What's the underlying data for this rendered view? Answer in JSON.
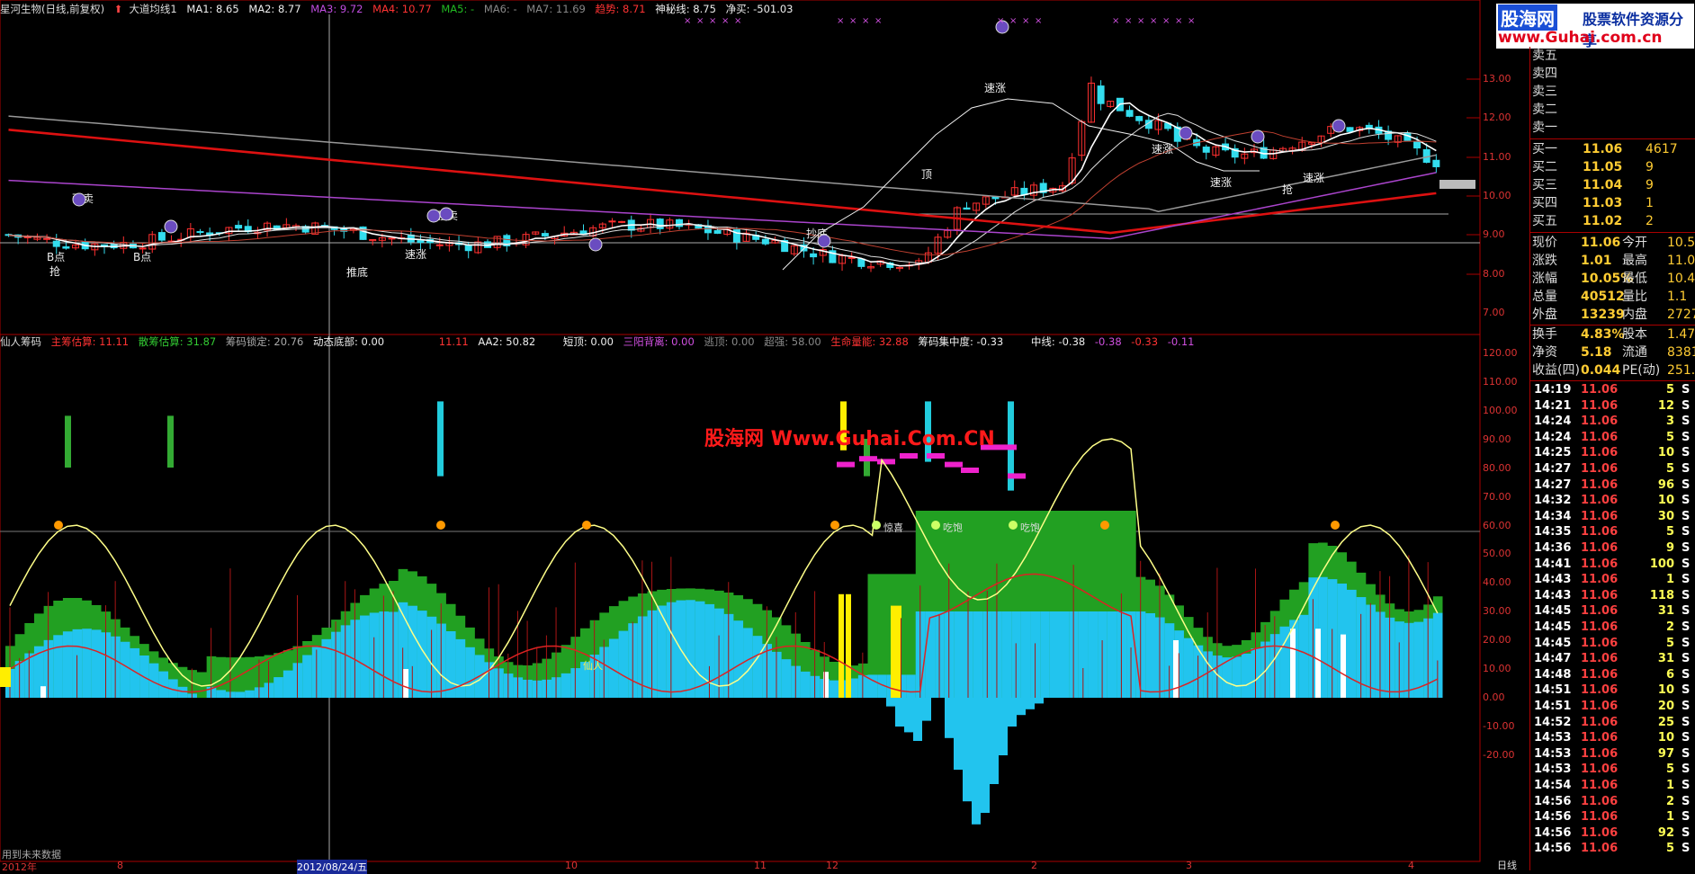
{
  "stock_header": {
    "title": "星河生物(日线,前复权)",
    "indicator": "大道均线1",
    "ma1": "MA1: 8.65",
    "ma2": "MA2: 8.77",
    "ma3": "MA3: 9.72",
    "ma4": "MA4: 10.77",
    "ma5": "MA5: -",
    "ma6": "MA6: -",
    "ma7": "MA7: 11.69",
    "trend": "趋势: 8.71",
    "secret": "神秘线: 8.75",
    "netbuy": "净买: -501.03"
  },
  "indicator_header": {
    "name": "仙人筹码",
    "main": "主筹估算: 11.11",
    "scatter": "散筹估算: 31.87",
    "lock": "筹码锁定: 20.76",
    "dynbottom": "动态底部: 0.00",
    "v1": "11.11",
    "aa2": "AA2: 50.82",
    "short_top": "短顶: 0.00",
    "sanyang": "三阳背离: 0.00",
    "escape": "逃顶: 0.00",
    "super": "超强: 58.00",
    "life": "生命量能: 32.88",
    "concentration": "筹码集中度: -0.33",
    "mid": "中线: -0.38",
    "m1": "-0.38",
    "m2": "-0.33",
    "m3": "-0.11"
  },
  "price_axis": [
    "13.00",
    "12.00",
    "11.00",
    "10.00",
    "9.00",
    "8.00",
    "7.00"
  ],
  "ind_axis": [
    "120.00",
    "110.00",
    "100.00",
    "90.00",
    "80.00",
    "70.00",
    "60.00",
    "50.00",
    "40.00",
    "30.00",
    "20.00",
    "10.00",
    "0.00",
    "-10.00",
    "-20.00"
  ],
  "time_axis": [
    "2012年",
    "8",
    "2012/08/24/五",
    "10",
    "11",
    "12",
    "2",
    "3",
    "4"
  ],
  "price_labels": [
    "顶",
    "速涨",
    "速涨",
    "速涨",
    "速涨",
    "速涨",
    "抢",
    "抄底",
    "抢",
    "B点",
    "B点",
    "推底",
    "强卖",
    "强卖"
  ],
  "ind_labels": {
    "xianren": "仙人",
    "pop1": "惊喜",
    "pop2": "吃饱",
    "pop3": "吃饱"
  },
  "watermark": "股海网 Www.Guhai.Com.CN",
  "logo": {
    "a": "股海网",
    "b": "股票软件资源分享",
    "c": "www.Guhai.com.cn"
  },
  "orderbook": {
    "sell": [
      {
        "label": "卖五",
        "price": "",
        "vol": ""
      },
      {
        "label": "卖四",
        "price": "",
        "vol": ""
      },
      {
        "label": "卖三",
        "price": "",
        "vol": ""
      },
      {
        "label": "卖二",
        "price": "",
        "vol": ""
      },
      {
        "label": "卖一",
        "price": "",
        "vol": ""
      }
    ],
    "buy": [
      {
        "label": "买一",
        "price": "11.06",
        "vol": "4617"
      },
      {
        "label": "买二",
        "price": "11.05",
        "vol": "9"
      },
      {
        "label": "买三",
        "price": "11.04",
        "vol": "9"
      },
      {
        "label": "买四",
        "price": "11.03",
        "vol": "1"
      },
      {
        "label": "买五",
        "price": "11.02",
        "vol": "2"
      }
    ]
  },
  "quote": [
    {
      "k1": "现价",
      "v1": "11.06",
      "k2": "今开",
      "v2": "10.5"
    },
    {
      "k1": "涨跌",
      "v1": "1.01",
      "k2": "最高",
      "v2": "11.0"
    },
    {
      "k1": "涨幅",
      "v1": "10.05%",
      "k2": "最低",
      "v2": "10.4"
    },
    {
      "k1": "总量",
      "v1": "40512",
      "k2": "量比",
      "v2": "1.1"
    },
    {
      "k1": "外盘",
      "v1": "13239",
      "k2": "内盘",
      "v2": "2727"
    },
    {
      "k1": "换手",
      "v1": "4.83%",
      "k2": "股本",
      "v2": "1.47"
    },
    {
      "k1": "净资",
      "v1": "5.18",
      "k2": "流通",
      "v2": "8381"
    },
    {
      "k1": "收益(四)",
      "v1": "0.044",
      "k2": "PE(动)",
      "v2": "251."
    }
  ],
  "ticks": [
    {
      "t": "14:19",
      "p": "11.06",
      "v": "5",
      "s": "S"
    },
    {
      "t": "14:21",
      "p": "11.06",
      "v": "12",
      "s": "S"
    },
    {
      "t": "14:24",
      "p": "11.06",
      "v": "3",
      "s": "S"
    },
    {
      "t": "14:24",
      "p": "11.06",
      "v": "5",
      "s": "S"
    },
    {
      "t": "14:25",
      "p": "11.06",
      "v": "10",
      "s": "S"
    },
    {
      "t": "14:27",
      "p": "11.06",
      "v": "5",
      "s": "S"
    },
    {
      "t": "14:27",
      "p": "11.06",
      "v": "96",
      "s": "S"
    },
    {
      "t": "14:32",
      "p": "11.06",
      "v": "10",
      "s": "S"
    },
    {
      "t": "14:34",
      "p": "11.06",
      "v": "30",
      "s": "S"
    },
    {
      "t": "14:35",
      "p": "11.06",
      "v": "5",
      "s": "S"
    },
    {
      "t": "14:36",
      "p": "11.06",
      "v": "9",
      "s": "S"
    },
    {
      "t": "14:41",
      "p": "11.06",
      "v": "100",
      "s": "S"
    },
    {
      "t": "14:43",
      "p": "11.06",
      "v": "1",
      "s": "S"
    },
    {
      "t": "14:43",
      "p": "11.06",
      "v": "118",
      "s": "S"
    },
    {
      "t": "14:45",
      "p": "11.06",
      "v": "31",
      "s": "S"
    },
    {
      "t": "14:45",
      "p": "11.06",
      "v": "2",
      "s": "S"
    },
    {
      "t": "14:45",
      "p": "11.06",
      "v": "5",
      "s": "S"
    },
    {
      "t": "14:47",
      "p": "11.06",
      "v": "31",
      "s": "S"
    },
    {
      "t": "14:48",
      "p": "11.06",
      "v": "6",
      "s": "S"
    },
    {
      "t": "14:51",
      "p": "11.06",
      "v": "10",
      "s": "S"
    },
    {
      "t": "14:51",
      "p": "11.06",
      "v": "20",
      "s": "S"
    },
    {
      "t": "14:52",
      "p": "11.06",
      "v": "25",
      "s": "S"
    },
    {
      "t": "14:53",
      "p": "11.06",
      "v": "10",
      "s": "S"
    },
    {
      "t": "14:53",
      "p": "11.06",
      "v": "97",
      "s": "S"
    },
    {
      "t": "14:53",
      "p": "11.06",
      "v": "5",
      "s": "S"
    },
    {
      "t": "14:54",
      "p": "11.06",
      "v": "1",
      "s": "S"
    },
    {
      "t": "14:56",
      "p": "11.06",
      "v": "2",
      "s": "S"
    },
    {
      "t": "14:56",
      "p": "11.06",
      "v": "1",
      "s": "S"
    },
    {
      "t": "14:56",
      "p": "11.06",
      "v": "92",
      "s": "S"
    },
    {
      "t": "14:56",
      "p": "11.06",
      "v": "5",
      "s": "S"
    },
    {
      "t": "14:56",
      "p": "11.06",
      "v": "1",
      "s": "S"
    }
  ],
  "footer": {
    "left": "用到未来数据",
    "right": "日线"
  },
  "colors": {
    "up": "#ff3030",
    "down": "#33ddee",
    "ma_white": "#ffffff",
    "ma_red": "#dd1111",
    "ma_purple": "#aa44cc",
    "ma_gray": "#999999",
    "fill_cyan": "#22c4ee",
    "fill_green": "#22a022",
    "line_yellow": "#ffff88"
  }
}
